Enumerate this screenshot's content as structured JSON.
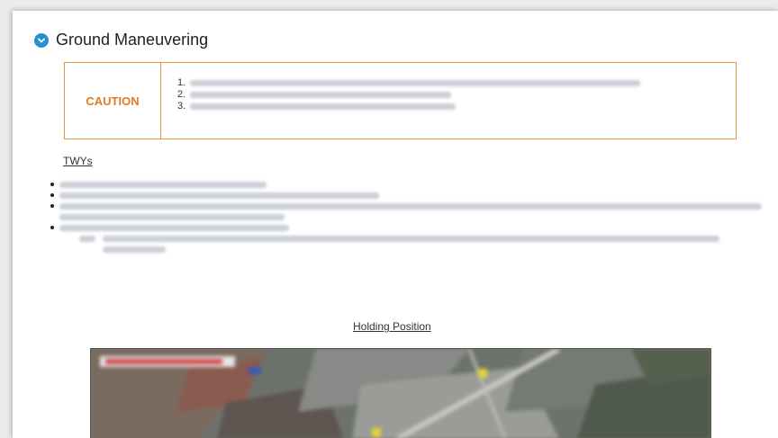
{
  "section": {
    "title": "Ground Maneuvering",
    "toggle_icon": "chevron-down-icon"
  },
  "caution": {
    "label": "CAUTION",
    "items": [
      {
        "num": "1."
      },
      {
        "num": "2."
      },
      {
        "num": "3."
      }
    ]
  },
  "twys": {
    "link_label": "TWYs"
  },
  "holding": {
    "link_label": "Holding Position"
  },
  "colors": {
    "accent_blue": "#2a8fd0",
    "caution_orange": "#e5953a",
    "caution_text": "#e07b26"
  }
}
